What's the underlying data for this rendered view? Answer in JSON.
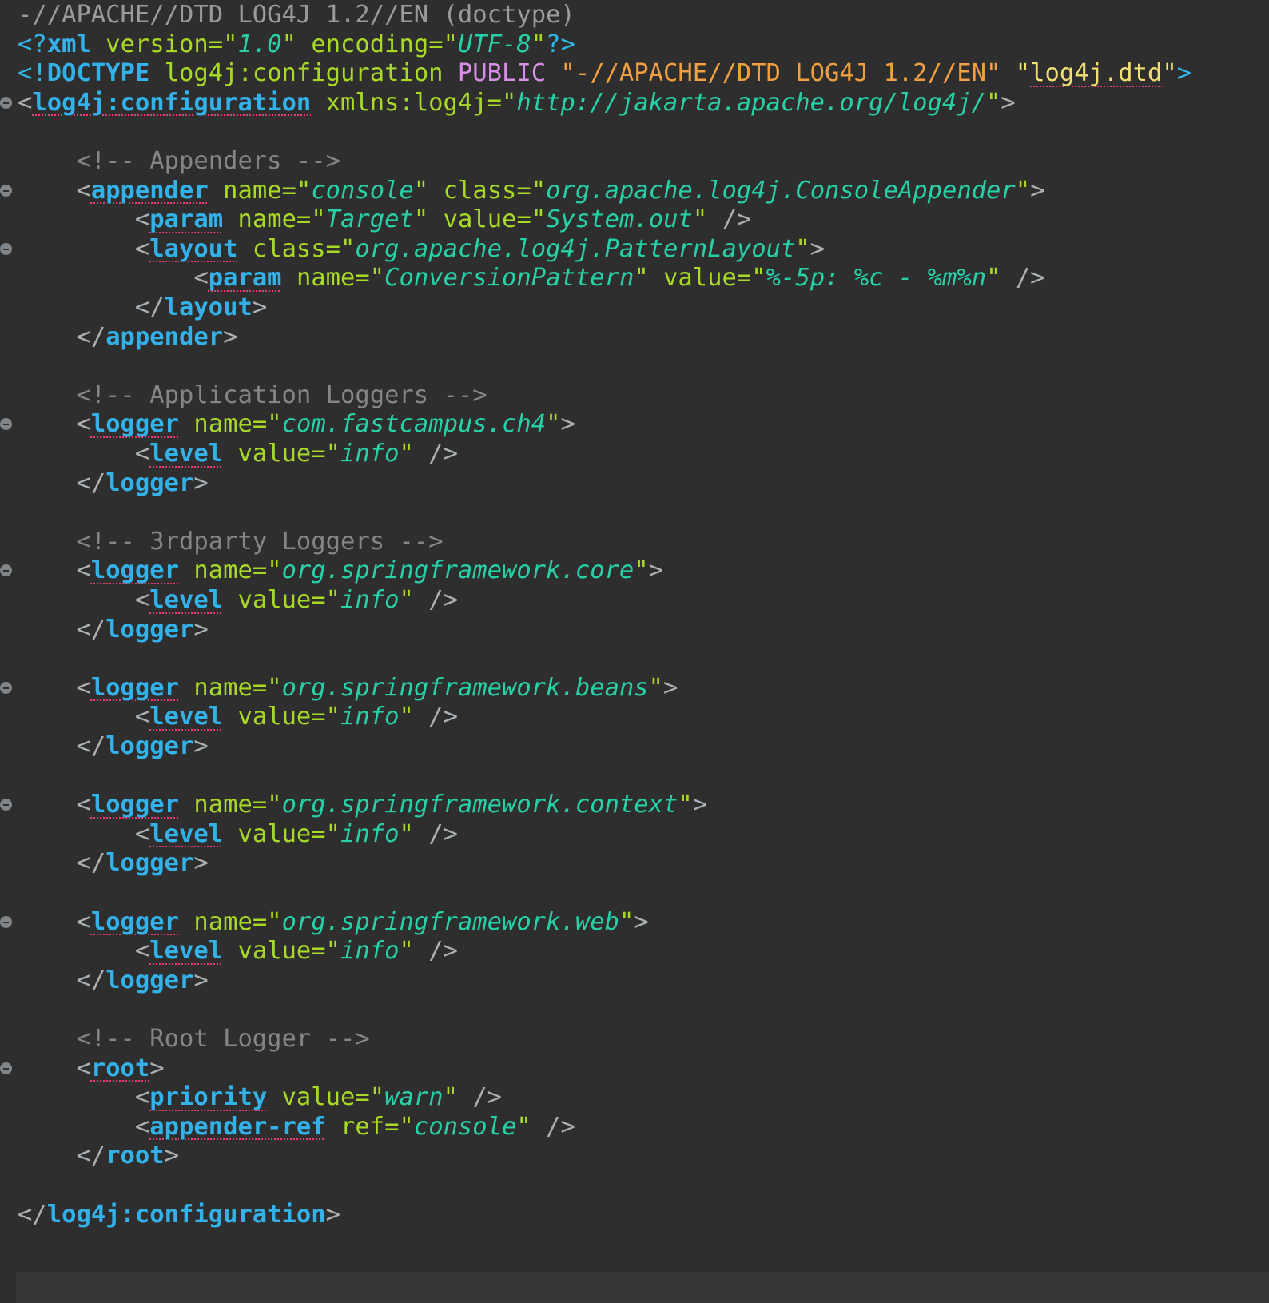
{
  "editor": {
    "lines": [
      {
        "text": "-//APACHE//DTD LOG4J 1.2//EN (doctype)"
      },
      {
        "text": "<?xml version=\"1.0\" encoding=\"UTF-8\"?>"
      },
      {
        "text": "<!DOCTYPE log4j:configuration PUBLIC \"-//APACHE//DTD LOG4J 1.2//EN\" \"log4j.dtd\">"
      },
      {
        "text": "<log4j:configuration xmlns:log4j=\"http://jakarta.apache.org/log4j/\">"
      },
      {
        "text": ""
      },
      {
        "text": "    <!-- Appenders -->"
      },
      {
        "text": "    <appender name=\"console\" class=\"org.apache.log4j.ConsoleAppender\">"
      },
      {
        "text": "        <param name=\"Target\" value=\"System.out\" />"
      },
      {
        "text": "        <layout class=\"org.apache.log4j.PatternLayout\">"
      },
      {
        "text": "            <param name=\"ConversionPattern\" value=\"%-5p: %c - %m%n\" />"
      },
      {
        "text": "        </layout>"
      },
      {
        "text": "    </appender>"
      },
      {
        "text": ""
      },
      {
        "text": "    <!-- Application Loggers -->"
      },
      {
        "text": "    <logger name=\"com.fastcampus.ch4\">"
      },
      {
        "text": "        <level value=\"info\" />"
      },
      {
        "text": "    </logger>"
      },
      {
        "text": ""
      },
      {
        "text": "    <!-- 3rdparty Loggers -->"
      },
      {
        "text": "    <logger name=\"org.springframework.core\">"
      },
      {
        "text": "        <level value=\"info\" />"
      },
      {
        "text": "    </logger>"
      },
      {
        "text": ""
      },
      {
        "text": "    <logger name=\"org.springframework.beans\">"
      },
      {
        "text": "        <level value=\"info\" />"
      },
      {
        "text": "    </logger>"
      },
      {
        "text": ""
      },
      {
        "text": "    <logger name=\"org.springframework.context\">"
      },
      {
        "text": "        <level value=\"info\" />"
      },
      {
        "text": "    </logger>"
      },
      {
        "text": ""
      },
      {
        "text": "    <logger name=\"org.springframework.web\">"
      },
      {
        "text": "        <level value=\"info\" />"
      },
      {
        "text": "    </logger>"
      },
      {
        "text": ""
      },
      {
        "text": "    <!-- Root Logger -->"
      },
      {
        "text": "    <root>"
      },
      {
        "text": "        <priority value=\"warn\" />"
      },
      {
        "text": "        <appender-ref ref=\"console\" />"
      },
      {
        "text": "    </root>"
      },
      {
        "text": ""
      },
      {
        "text": "</log4j:configuration>"
      }
    ],
    "fold_markers": [
      3,
      6,
      8,
      14,
      19,
      23,
      27,
      31,
      36
    ],
    "colors": {
      "background": "#2e2e2e",
      "tag": "#33b2ea",
      "attribute": "#a8d926",
      "attribute_value": "#27d0a6",
      "comment": "#858585",
      "doctype_public_id": "#f0a040",
      "doctype_system_id": "#f1df74",
      "keyword": "#d98ee8",
      "squiggle": "#ef3d7a"
    }
  }
}
